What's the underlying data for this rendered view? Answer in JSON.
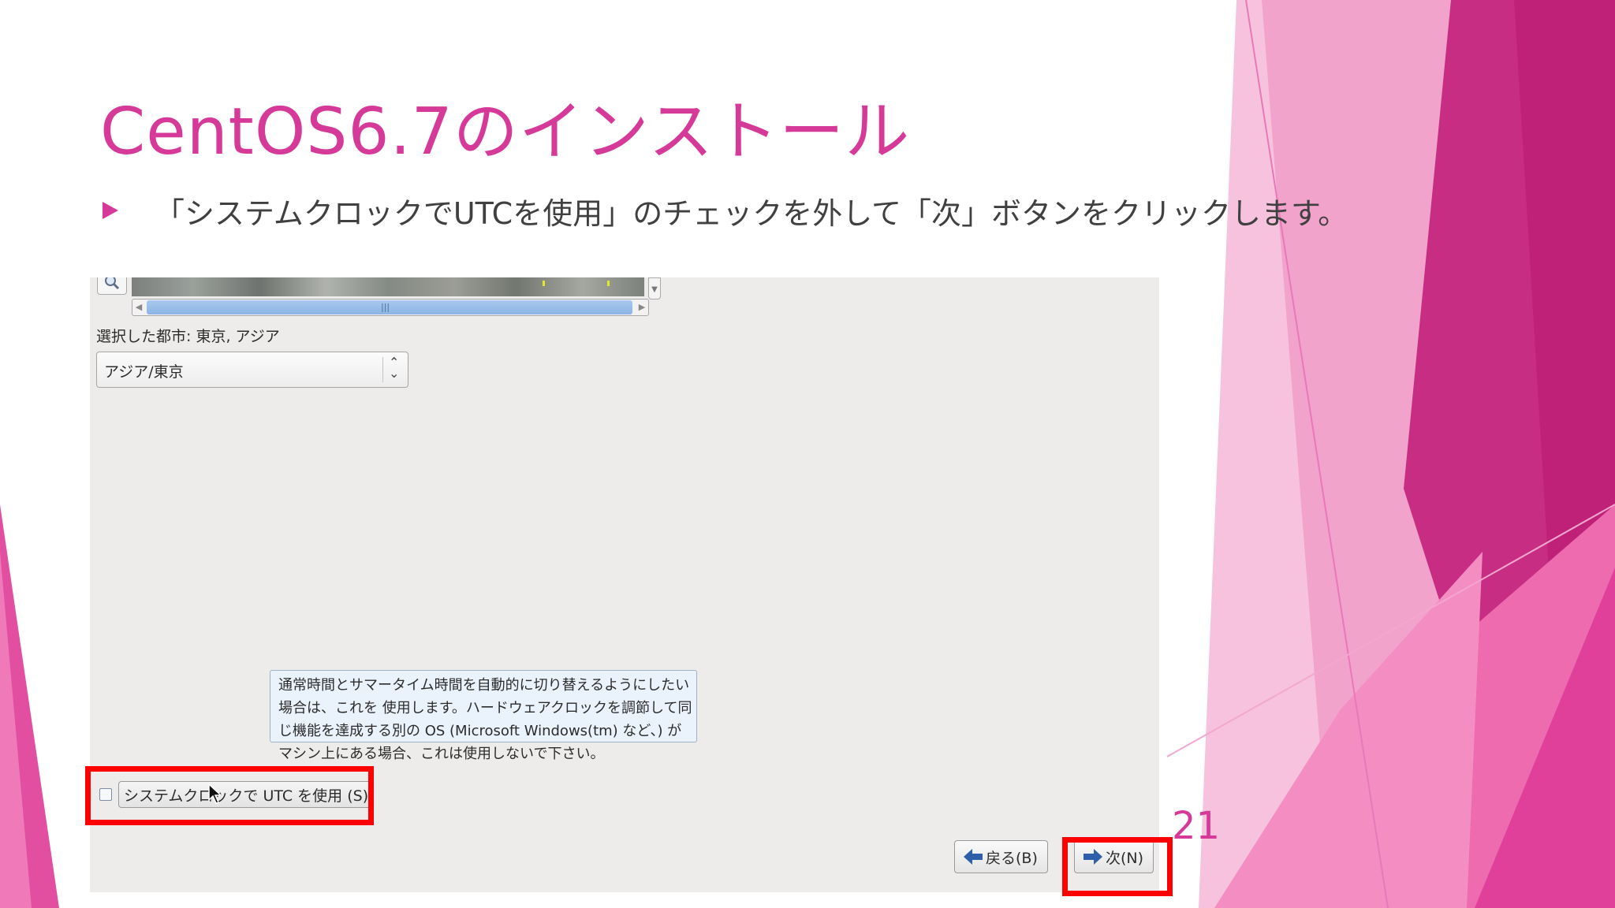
{
  "colors": {
    "accent": "#d63a98",
    "highlight": "#ff0000",
    "installer_bg": "#edeceb"
  },
  "slide": {
    "title": "CentOS6.7のインストール",
    "bullet": "「システムクロックでUTCを使用」のチェックを外して「次」ボタンをクリックします。",
    "page_number": "21"
  },
  "installer": {
    "map_toolbar": {
      "zoom_icon": "magnifier-icon"
    },
    "selected_city_label": "選択した都市: 東京, アジア",
    "timezone_select": {
      "value": "アジア/東京",
      "icon": "up-down-chevron-icon"
    },
    "tooltip": {
      "lines": [
        "通常時間とサマータイム時間を自動的に切り替えるようにしたい",
        "場合は、これを 使用します。ハードウェアクロックを調節して同",
        "じ機能を達成する別の OS (Microsoft Windows(tm) など、) が",
        "マシン上にある場合、これは使用しないで下さい。"
      ]
    },
    "utc_checkbox": {
      "checked": false,
      "label": "システムクロックで UTC を使用 (S)"
    },
    "buttons": {
      "back": {
        "label": "戻る(B)",
        "icon": "arrow-left-icon"
      },
      "next": {
        "label": "次(N)",
        "icon": "arrow-right-icon"
      }
    }
  }
}
